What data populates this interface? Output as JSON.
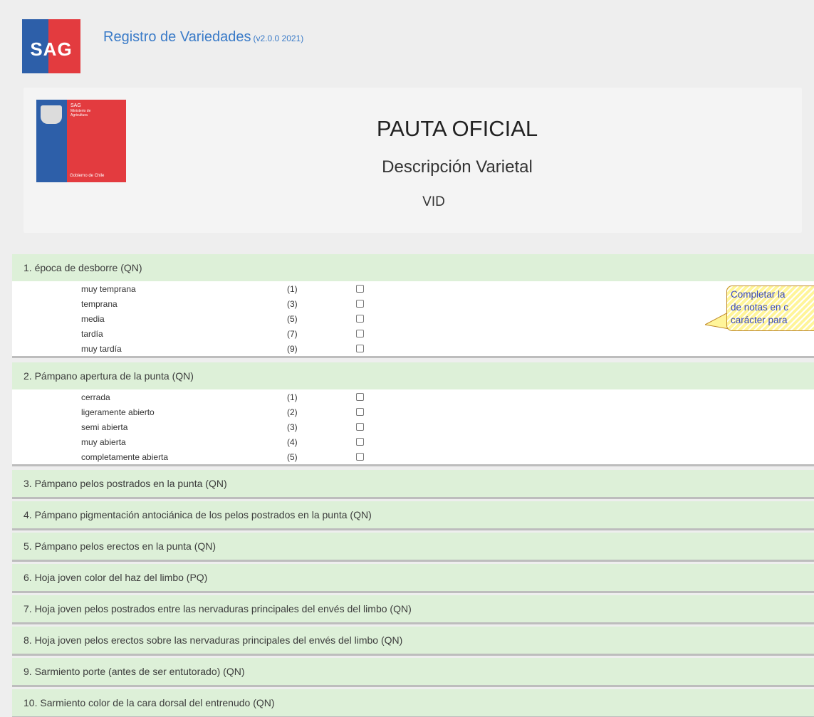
{
  "header": {
    "logo_text": "SAG",
    "app_title": "Registro de Variedades",
    "app_version": "(v2.0.0 2021)"
  },
  "headcard": {
    "logo_sag_text": "SAG",
    "logo_ministry_text": "Ministerio de Agricultura",
    "logo_gov_text": "Gobierno de Chile",
    "title": "PAUTA OFICIAL",
    "subtitle": "Descripción Varietal",
    "species": "VID"
  },
  "callout": {
    "lines": [
      "Completar la",
      "de notas en c",
      "carácter para"
    ]
  },
  "sections": [
    {
      "title": "1. época de desborre (QN)",
      "options": [
        {
          "label": "muy temprana",
          "code": "(1)"
        },
        {
          "label": "temprana",
          "code": "(3)"
        },
        {
          "label": "media",
          "code": "(5)"
        },
        {
          "label": "tardía",
          "code": "(7)"
        },
        {
          "label": "muy tardía",
          "code": "(9)"
        }
      ]
    },
    {
      "title": "2. Pámpano apertura de la punta (QN)",
      "options": [
        {
          "label": "cerrada",
          "code": "(1)"
        },
        {
          "label": "ligeramente abierto",
          "code": "(2)"
        },
        {
          "label": "semi abierta",
          "code": "(3)"
        },
        {
          "label": "muy abierta",
          "code": "(4)"
        },
        {
          "label": "completamente abierta",
          "code": "(5)"
        }
      ]
    },
    {
      "title": "3. Pámpano pelos postrados en la punta (QN)"
    },
    {
      "title": "4. Pámpano pigmentación antociánica de los pelos postrados en la punta (QN)"
    },
    {
      "title": "5. Pámpano pelos erectos en la punta (QN)"
    },
    {
      "title": "6. Hoja joven color del haz del limbo (PQ)"
    },
    {
      "title": "7. Hoja joven pelos postrados entre las nervaduras principales del envés del limbo (QN)"
    },
    {
      "title": "8. Hoja joven pelos erectos sobre las nervaduras principales del envés del limbo (QN)"
    },
    {
      "title": "9. Sarmiento porte (antes de ser entutorado) (QN)"
    },
    {
      "title": "10. Sarmiento color de la cara dorsal del entrenudo (QN)"
    }
  ]
}
